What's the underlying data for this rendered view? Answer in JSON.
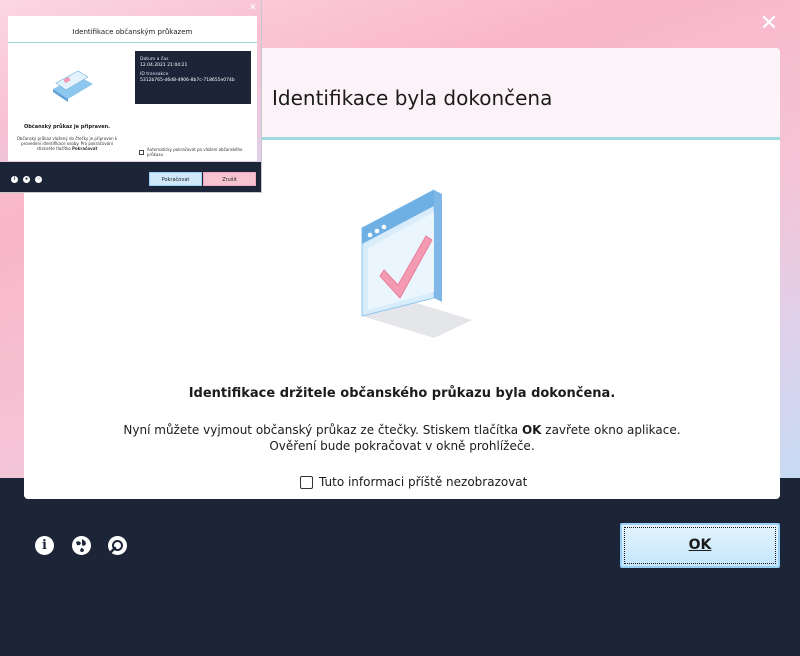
{
  "main_window": {
    "close_icon": "close-icon",
    "title": "Identifikace byla dokončena",
    "heading": "Identifikace držitele občanského průkazu byla dokončena.",
    "description_line1_pre": "Nyní můžete vyjmout občanský průkaz ze čtečky. Stiskem tlačítka ",
    "description_line1_bold": "OK",
    "description_line1_post": " zavřete okno aplikace.",
    "description_line2": "Ověření bude pokračovat v okně prohlížeče.",
    "checkbox_label": "Tuto informaci příště nezobrazovat",
    "checkbox_checked": false,
    "ok_button": "OK",
    "footer_icons": [
      "info-icon",
      "globe-icon",
      "support-icon"
    ],
    "colors": {
      "accent_line": "#9fdbe1",
      "footer_bg": "#1c2538",
      "ok_button_bg": "#c5e6fb",
      "check_mark": "#f48aa6"
    }
  },
  "mini_window": {
    "title": "Identifikace občanským průkazem",
    "info_date_label": "Datum a čas",
    "info_date_value": "12.04.2021 21:04:21",
    "info_id_label": "ID transakce",
    "info_id_value": "5312b765-d6d8-4906-8b7c-718655e074b",
    "ready_text": "Občanský průkaz je připraven.",
    "ready_desc": "Občanský průkaz vložený do čtečky je připraven k provedení identifikace osoby. Pro pokračování stiskněte tlačítko",
    "ready_desc_bold": "Pokračovat",
    "checkbox_label": "Automaticky pokračovat po vložení občanského průkazu",
    "continue_button": "Pokračovat",
    "cancel_button": "Zrušit"
  }
}
